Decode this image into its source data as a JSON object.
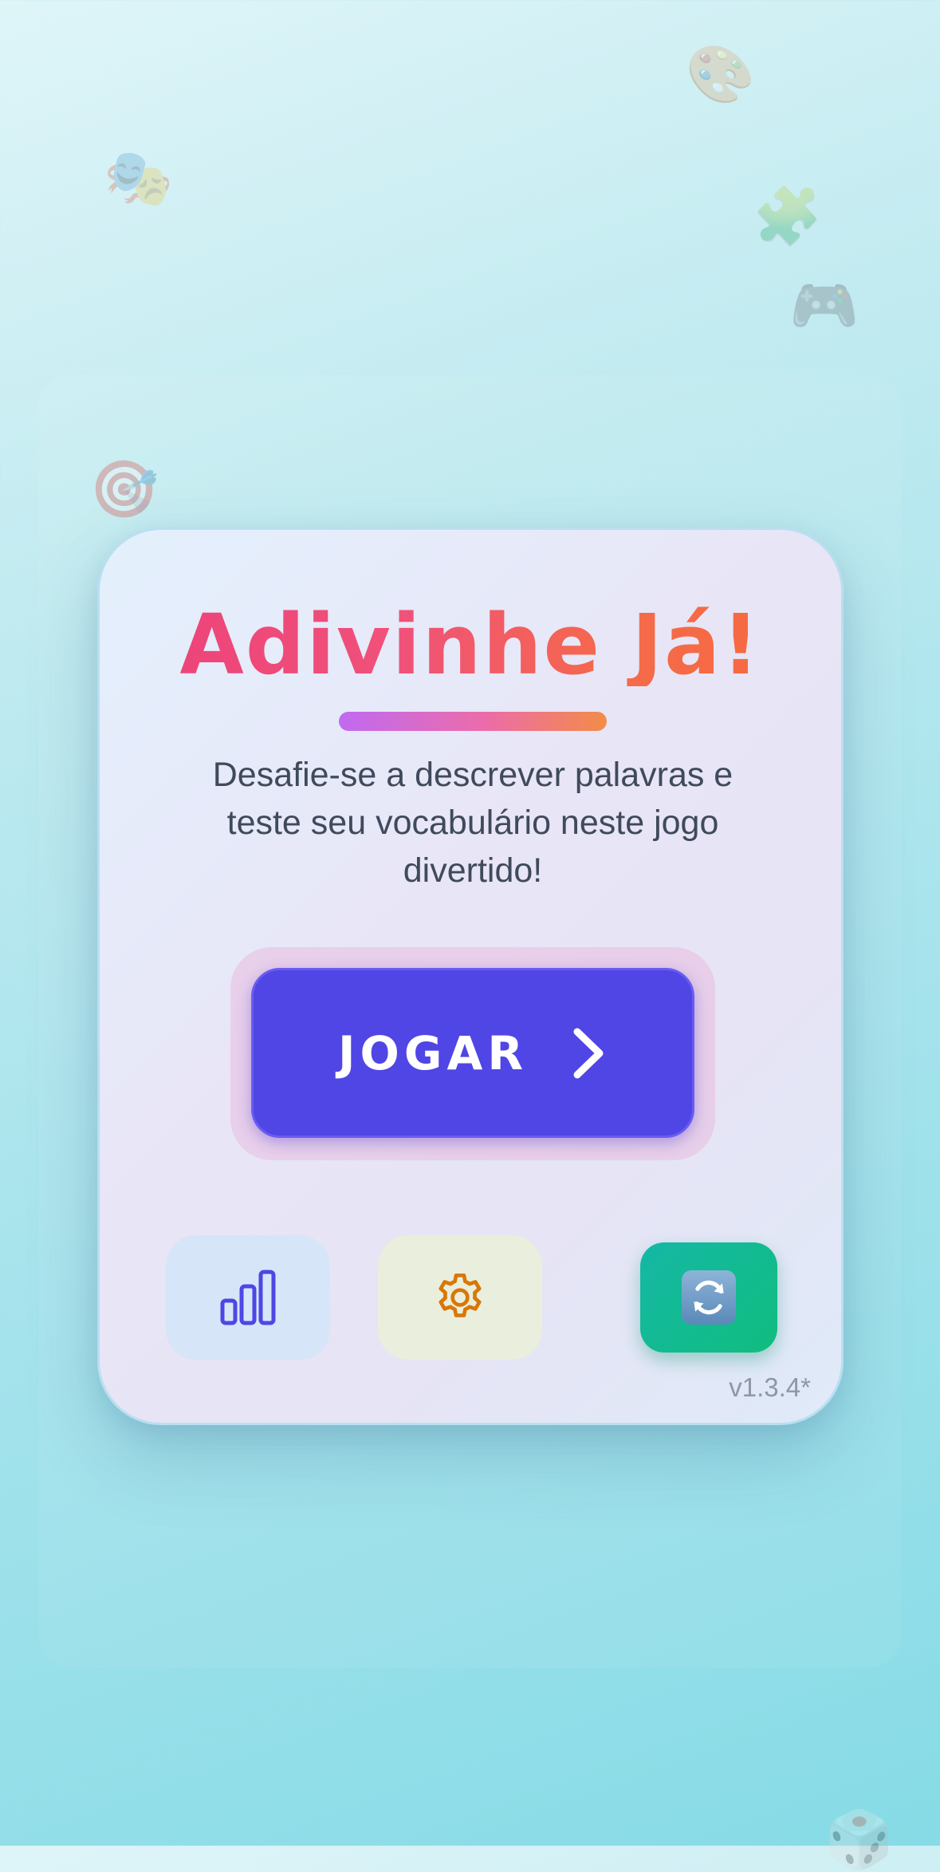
{
  "app": {
    "title": "Adivinhe Já!",
    "subtitle": "Desafie-se a descrever palavras e teste seu vocabulário neste jogo divertido!",
    "version": "v1.3.4*"
  },
  "play_button": {
    "label": "JOGAR",
    "icon": "chevron-right-icon"
  },
  "actions": [
    {
      "name": "stats",
      "icon": "bar-chart-icon"
    },
    {
      "name": "settings",
      "icon": "gear-icon"
    },
    {
      "name": "refresh",
      "icon": "refresh-icon"
    }
  ],
  "decorations": [
    {
      "icon": "theater-masks-icon",
      "glyph": "🎭"
    },
    {
      "icon": "palette-icon",
      "glyph": "🎨"
    },
    {
      "icon": "puzzle-piece-icon",
      "glyph": "🧩"
    },
    {
      "icon": "game-controller-icon",
      "glyph": "🎮"
    },
    {
      "icon": "dart-target-icon",
      "glyph": "🎯"
    },
    {
      "icon": "dice-icon",
      "glyph": "🎲"
    }
  ],
  "colors": {
    "primary": "#4f46e5",
    "title_start": "#ec4079",
    "title_end": "#f66b3d",
    "refresh_bg": "#10b981",
    "settings_icon": "#d97706"
  }
}
